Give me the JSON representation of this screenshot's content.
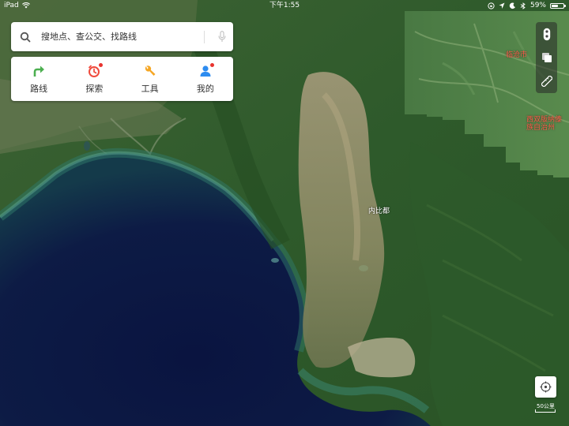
{
  "status_bar": {
    "device": "iPad",
    "time": "下午1:55",
    "battery": "59%",
    "battery_level": 0.59
  },
  "search": {
    "placeholder": "搜地点、查公交、找路线"
  },
  "quick_actions": [
    {
      "label": "路线",
      "icon": "route-arrow-icon",
      "color": "#4caf50"
    },
    {
      "label": "探索",
      "icon": "explore-timer-icon",
      "color": "#f04a3c"
    },
    {
      "label": "工具",
      "icon": "wrench-icon",
      "color": "#f5a623"
    },
    {
      "label": "我的",
      "icon": "person-icon",
      "color": "#2d8cf0"
    }
  ],
  "right_tools": [
    {
      "icon": "traffic-light-icon"
    },
    {
      "icon": "layers-icon"
    },
    {
      "icon": "ruler-icon"
    }
  ],
  "map": {
    "type": "satellite",
    "labels": {
      "city_upper": "临沧市",
      "region_upper": "西双版纳傣族自治州",
      "region_line1": "西双版纳傣",
      "region_line2": "族自治州",
      "center_city": "内比都"
    },
    "scale": "50公里"
  },
  "colors": {
    "accent_blue": "#2d8cf0",
    "accent_red": "#e8332e",
    "ocean": "#0c1a3f",
    "land_green": "#2f5a2c"
  }
}
